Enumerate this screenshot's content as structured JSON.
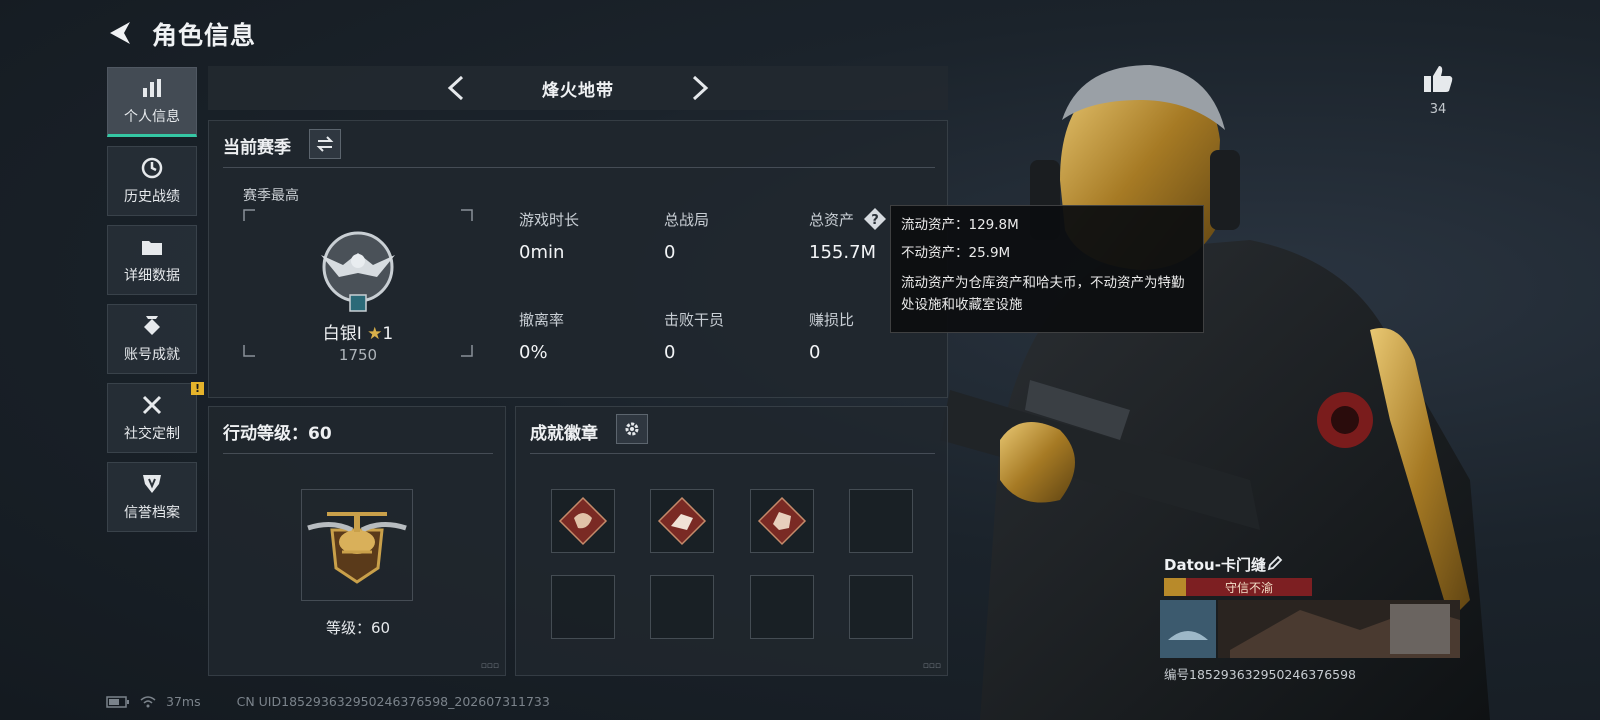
{
  "header": {
    "title": "角色信息"
  },
  "nav": {
    "items": [
      {
        "label": "个人信息",
        "icon": "bar-chart-icon",
        "active": true
      },
      {
        "label": "历史战绩",
        "icon": "clock-icon"
      },
      {
        "label": "详细数据",
        "icon": "folder-icon"
      },
      {
        "label": "账号成就",
        "icon": "medal-icon"
      },
      {
        "label": "社交定制",
        "icon": "wrench-icon",
        "badge": "!"
      },
      {
        "label": "信誉档案",
        "icon": "shield-icon"
      }
    ]
  },
  "mode": {
    "title": "烽火地带"
  },
  "season": {
    "title": "当前赛季",
    "best_label": "赛季最高",
    "rank_name": "白银I",
    "rank_star_count": "1",
    "rank_score": "1750",
    "stats": [
      {
        "label": "游戏时长",
        "value": "0min"
      },
      {
        "label": "总战局",
        "value": "0"
      },
      {
        "label": "总资产",
        "value": "155.7M"
      },
      {
        "label": "撤离率",
        "value": "0%"
      },
      {
        "label": "击败干员",
        "value": "0"
      },
      {
        "label": "赚损比",
        "value": "0"
      }
    ]
  },
  "tooltip": {
    "liquid": "流动资产：129.8M",
    "fixed": "不动资产：25.9M",
    "desc": "流动资产为仓库资产和哈夫币，不动资产为特勤处设施和收藏室设施"
  },
  "level": {
    "title": "行动等级：60",
    "level_text": "等级：60"
  },
  "badges": {
    "title": "成就徽章",
    "filled": 3,
    "total": 8
  },
  "like": {
    "count": "34"
  },
  "player": {
    "name": "Datou-卡门缝",
    "title_tag": "守信不渝",
    "id": "编号185293632950246376598"
  },
  "status": {
    "ping": "37ms",
    "uid": "CN UID185293632950246376598_202607311733"
  },
  "colors": {
    "accent": "#35c7a4",
    "gold": "#c9a04a",
    "badge_red": "#7a2a24"
  }
}
